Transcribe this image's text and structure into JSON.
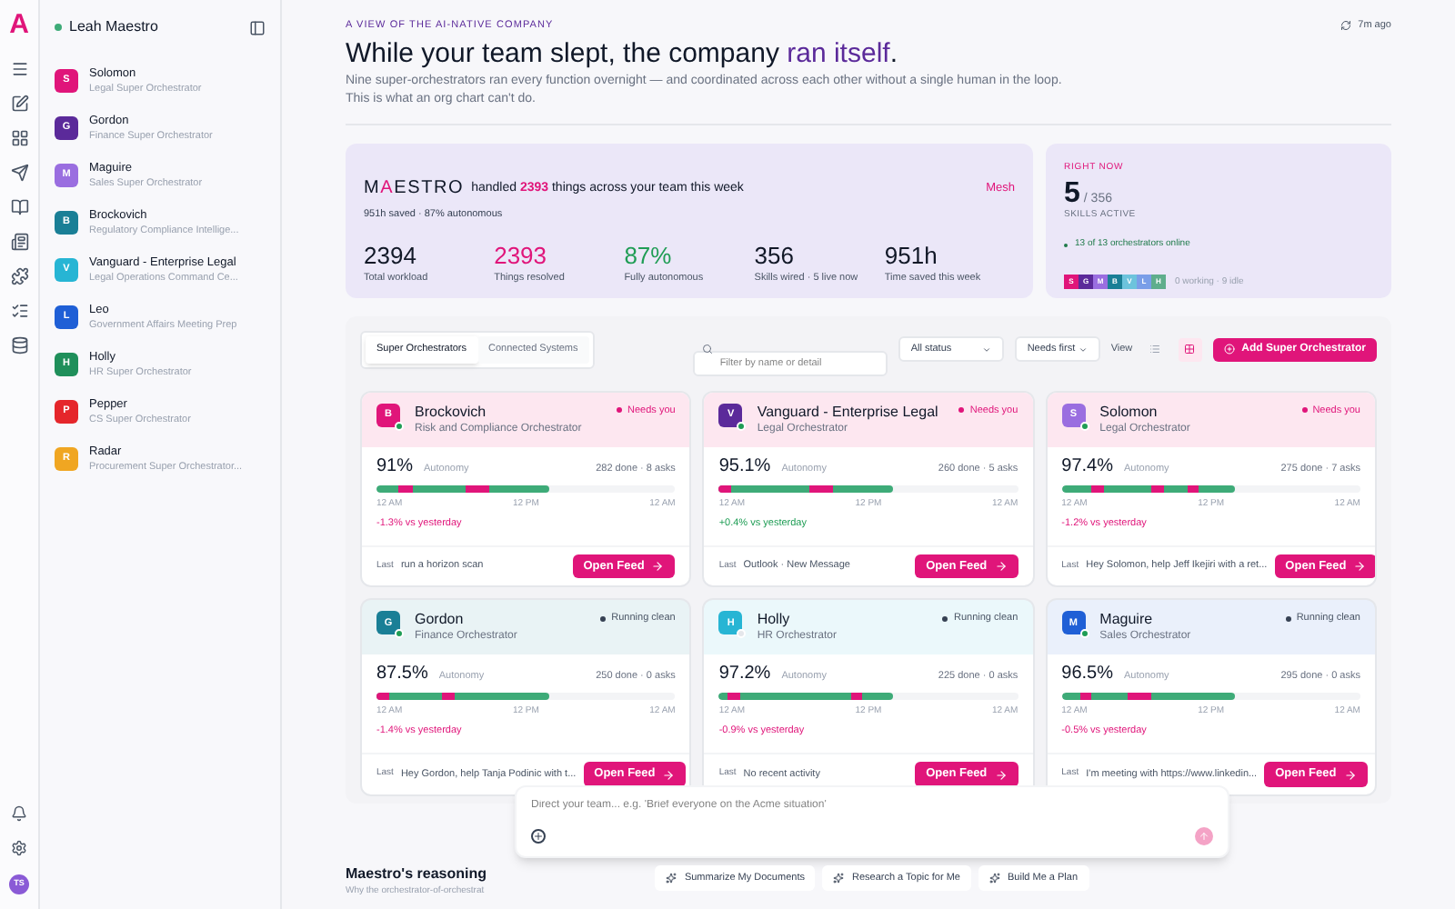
{
  "rail": {
    "logo": "A",
    "avatar": "TS"
  },
  "sidebar": {
    "user": "Leah Maestro",
    "online": true,
    "items": [
      {
        "initial": "S",
        "name": "Solomon",
        "role": "Legal Super Orchestrator",
        "color": "#e0157a"
      },
      {
        "initial": "G",
        "name": "Gordon",
        "role": "Finance Super Orchestrator",
        "color": "#5b2a9a"
      },
      {
        "initial": "M",
        "name": "Maguire",
        "role": "Sales Super Orchestrator",
        "color": "#9a6ee0"
      },
      {
        "initial": "B",
        "name": "Brockovich",
        "role": "Regulatory Compliance Intellige...",
        "color": "#1a7f96"
      },
      {
        "initial": "V",
        "name": "Vanguard - Enterprise Legal",
        "role": "Legal Operations Command Ce...",
        "color": "#27b5d4"
      },
      {
        "initial": "L",
        "name": "Leo",
        "role": "Government Affairs Meeting Prep",
        "color": "#1f5fd6"
      },
      {
        "initial": "H",
        "name": "Holly",
        "role": "HR Super Orchestrator",
        "color": "#1f8f5a"
      },
      {
        "initial": "P",
        "name": "Pepper",
        "role": "CS Super Orchestrator",
        "color": "#e5262b"
      },
      {
        "initial": "R",
        "name": "Radar",
        "role": "Procurement Super Orchestrator...",
        "color": "#f0a622"
      }
    ]
  },
  "header": {
    "kicker": "A VIEW OF THE AI-NATIVE COMPANY",
    "title": "While your team slept, the company",
    "title_accent": "ran itself",
    "title_end": ".",
    "subtitle": "Nine super-orchestrators ran every function overnight — and coordinated across each other without a single human in the loop.",
    "subtitle_2": "This is what an org chart can't do.",
    "updated": "7m ago"
  },
  "summary": {
    "brand": [
      {
        "text": "M",
        "accent": false
      },
      {
        "text": "A",
        "accent": true
      },
      {
        "text": "ESTRO",
        "accent": false
      }
    ],
    "headline_pre": "handled",
    "headline_count": "2393",
    "headline_post": "things across your team this week",
    "subline": "951h saved · 87% autonomous",
    "mode": "Mesh",
    "stats": [
      {
        "value": "2394",
        "label": "Total workload",
        "color": "#111827"
      },
      {
        "value": "2393",
        "label": "Things resolved",
        "color": "#e0157a"
      },
      {
        "value": "87%",
        "label": "Fully autonomous",
        "color": "#1f9d55"
      },
      {
        "value": "356",
        "label": "Skills wired · 5 live now",
        "color": "#111827"
      },
      {
        "value": "951h",
        "label": "Time saved this week",
        "color": "#111827"
      }
    ]
  },
  "right_now": {
    "label": "RIGHT NOW",
    "count": "5",
    "total": "/ 356",
    "caption": "SKILLS ACTIVE",
    "online": "13 of 13 orchestrators online",
    "avatars": [
      {
        "letter": "S",
        "color": "#e0157a"
      },
      {
        "letter": "G",
        "color": "#5b2a9a"
      },
      {
        "letter": "M",
        "color": "#9a6ee0"
      },
      {
        "letter": "B",
        "color": "#1a7f96"
      },
      {
        "letter": "V",
        "color": "#6cc3dc"
      },
      {
        "letter": "L",
        "color": "#7a9ee8"
      },
      {
        "letter": "H",
        "color": "#5fae8c"
      }
    ],
    "activity": "0 working · 9 idle"
  },
  "toolbar": {
    "tabs": [
      {
        "label": "Super Orchestrators",
        "selected": true
      },
      {
        "label": "Connected Systems",
        "selected": false
      }
    ],
    "search": {
      "placeholder": "Filter by name or detail"
    },
    "status_filter": "All status",
    "sort": "Needs first",
    "view_label": "View",
    "views": [
      {
        "kind": "list",
        "selected": false
      },
      {
        "kind": "grid",
        "selected": true
      }
    ],
    "add_button": "Add Super Orchestrator"
  },
  "cards": [
    {
      "initial": "B",
      "name": "Brockovich",
      "role": "Risk and Compliance Orchestrator",
      "color": "#e0157a",
      "online": true,
      "status": "Needs you",
      "needs_attention": true,
      "autonomy": "91%",
      "autonomy_label": "Autonomy",
      "counts": "282 done · 8 asks",
      "axis": [
        "12 AM",
        "12 PM",
        "12 AM"
      ],
      "delta": "-1.3% vs yesterday",
      "improved": false,
      "last_label": "Last",
      "last": "run a horizon scan",
      "button": "Open Feed"
    },
    {
      "initial": "V",
      "name": "Vanguard - Enterprise Legal",
      "role": "Legal Orchestrator",
      "color": "#5b2a9a",
      "online": true,
      "status": "Needs you",
      "needs_attention": true,
      "autonomy": "95.1%",
      "autonomy_label": "Autonomy",
      "counts": "260 done · 5 asks",
      "axis": [
        "12 AM",
        "12 PM",
        "12 AM"
      ],
      "delta": "+0.4% vs yesterday",
      "improved": true,
      "last_label": "Last",
      "last": "Outlook · New Message",
      "button": "Open Feed"
    },
    {
      "initial": "S",
      "name": "Solomon",
      "role": "Legal Orchestrator",
      "color": "#9a6ee0",
      "online": true,
      "status": "Needs you",
      "needs_attention": true,
      "autonomy": "97.4%",
      "autonomy_label": "Autonomy",
      "counts": "275 done · 7 asks",
      "axis": [
        "12 AM",
        "12 PM",
        "12 AM"
      ],
      "delta": "-1.2% vs yesterday",
      "improved": false,
      "last_label": "Last",
      "last": "Hey Solomon, help Jeff Ikejiri with a ret...",
      "button": "Open Feed"
    },
    {
      "initial": "G",
      "name": "Gordon",
      "role": "Finance Orchestrator",
      "color": "#1a7f96",
      "online": true,
      "status": "Running clean",
      "needs_attention": false,
      "autonomy": "87.5%",
      "autonomy_label": "Autonomy",
      "counts": "250 done · 0 asks",
      "axis": [
        "12 AM",
        "12 PM",
        "12 AM"
      ],
      "delta": "-1.4% vs yesterday",
      "improved": false,
      "last_label": "Last",
      "last": "Hey Gordon, help Tanja Podinic with t...",
      "button": "Open Feed"
    },
    {
      "initial": "H",
      "name": "Holly",
      "role": "HR Orchestrator",
      "color": "#27b5d4",
      "online": false,
      "status": "Running clean",
      "needs_attention": false,
      "autonomy": "97.2%",
      "autonomy_label": "Autonomy",
      "counts": "225 done · 0 asks",
      "axis": [
        "12 AM",
        "12 PM",
        "12 AM"
      ],
      "delta": "-0.9% vs yesterday",
      "improved": false,
      "last_label": "Last",
      "last": "No recent activity",
      "button": "Open Feed"
    },
    {
      "initial": "M",
      "name": "Maguire",
      "role": "Sales Orchestrator",
      "color": "#1f5fd6",
      "online": true,
      "status": "Running clean",
      "needs_attention": false,
      "autonomy": "96.5%",
      "autonomy_label": "Autonomy",
      "counts": "295 done · 0 asks",
      "axis": [
        "12 AM",
        "12 PM",
        "12 AM"
      ],
      "delta": "-0.5% vs yesterday",
      "improved": false,
      "last_label": "Last",
      "last": "I'm meeting with https://www.linkedin...",
      "button": "Open Feed"
    }
  ],
  "composer": {
    "placeholder": "Direct your team... e.g. 'Brief everyone on the Acme situation'",
    "chips": [
      "Summarize My Documents",
      "Research a Topic for Me",
      "Build Me a Plan"
    ]
  },
  "reasoning": {
    "title": "Maestro's reasoning",
    "subtitle": "Why the orchestrator-of-orchestrat"
  }
}
